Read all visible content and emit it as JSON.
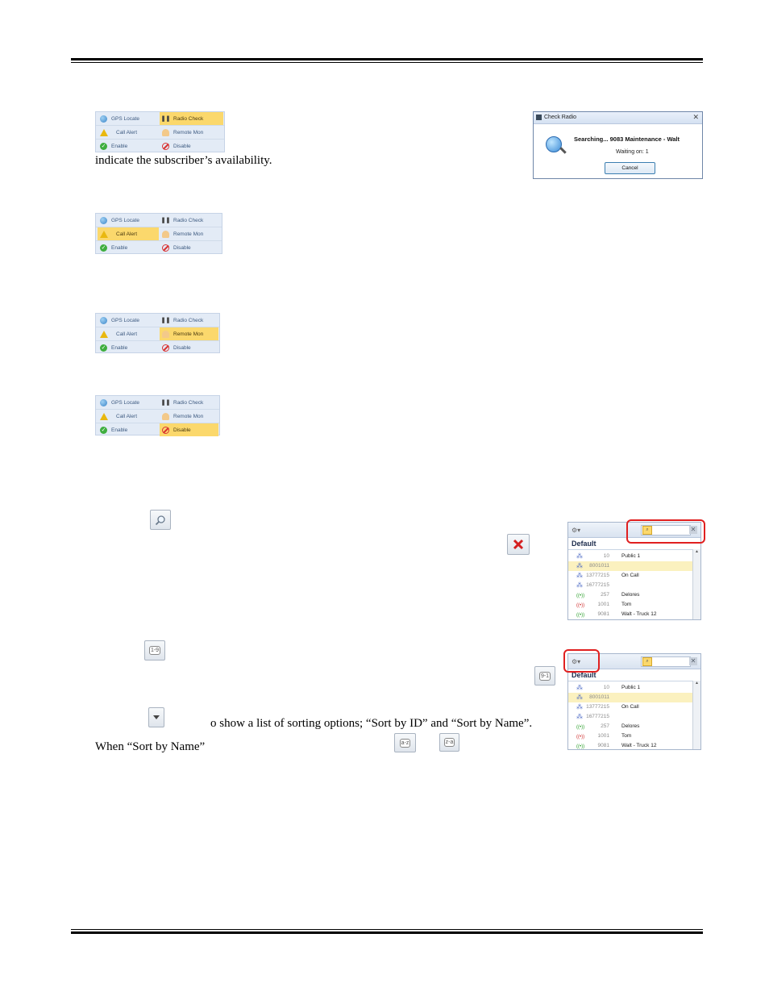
{
  "menu_labels": {
    "gps_locate": "GPS Locate",
    "radio_check": "Radio Check",
    "call_alert": "Call Alert",
    "remote_mon": "Remote Mon",
    "enable": "Enable",
    "disable": "Disable"
  },
  "body_text": {
    "availability": "indicate the subscriber’s availability.",
    "sorting_options": "o show a list of sorting options; “Sort by ID” and  “Sort by Name”.",
    "when_sort": "When “Sort by Name”"
  },
  "check_radio_dialog": {
    "title": "Check Radio",
    "searching": "Searching... 9083 Maintenance - Walt",
    "waiting": "Waiting on: 1",
    "cancel": "Cancel"
  },
  "icon_buttons": {
    "sort_asc_id": "1-9",
    "sort_desc_id": "9-1",
    "sort_asc_name": "a-z",
    "sort_desc_name": "z-a"
  },
  "list_panel": {
    "group": "Default",
    "rows": [
      {
        "id": "10",
        "name": "Public 1",
        "type": "talkgroup"
      },
      {
        "id": "8001011",
        "name": "",
        "type": "talkgroup"
      },
      {
        "id": "13777215",
        "name": "On Call",
        "type": "talkgroup"
      },
      {
        "id": "16777215",
        "name": "",
        "type": "talkgroup"
      },
      {
        "id": "257",
        "name": "Delores",
        "type": "radio"
      },
      {
        "id": "1001",
        "name": "Tom",
        "type": "radio-red"
      },
      {
        "id": "9081",
        "name": "Walt - Truck 12",
        "type": "radio"
      }
    ]
  }
}
